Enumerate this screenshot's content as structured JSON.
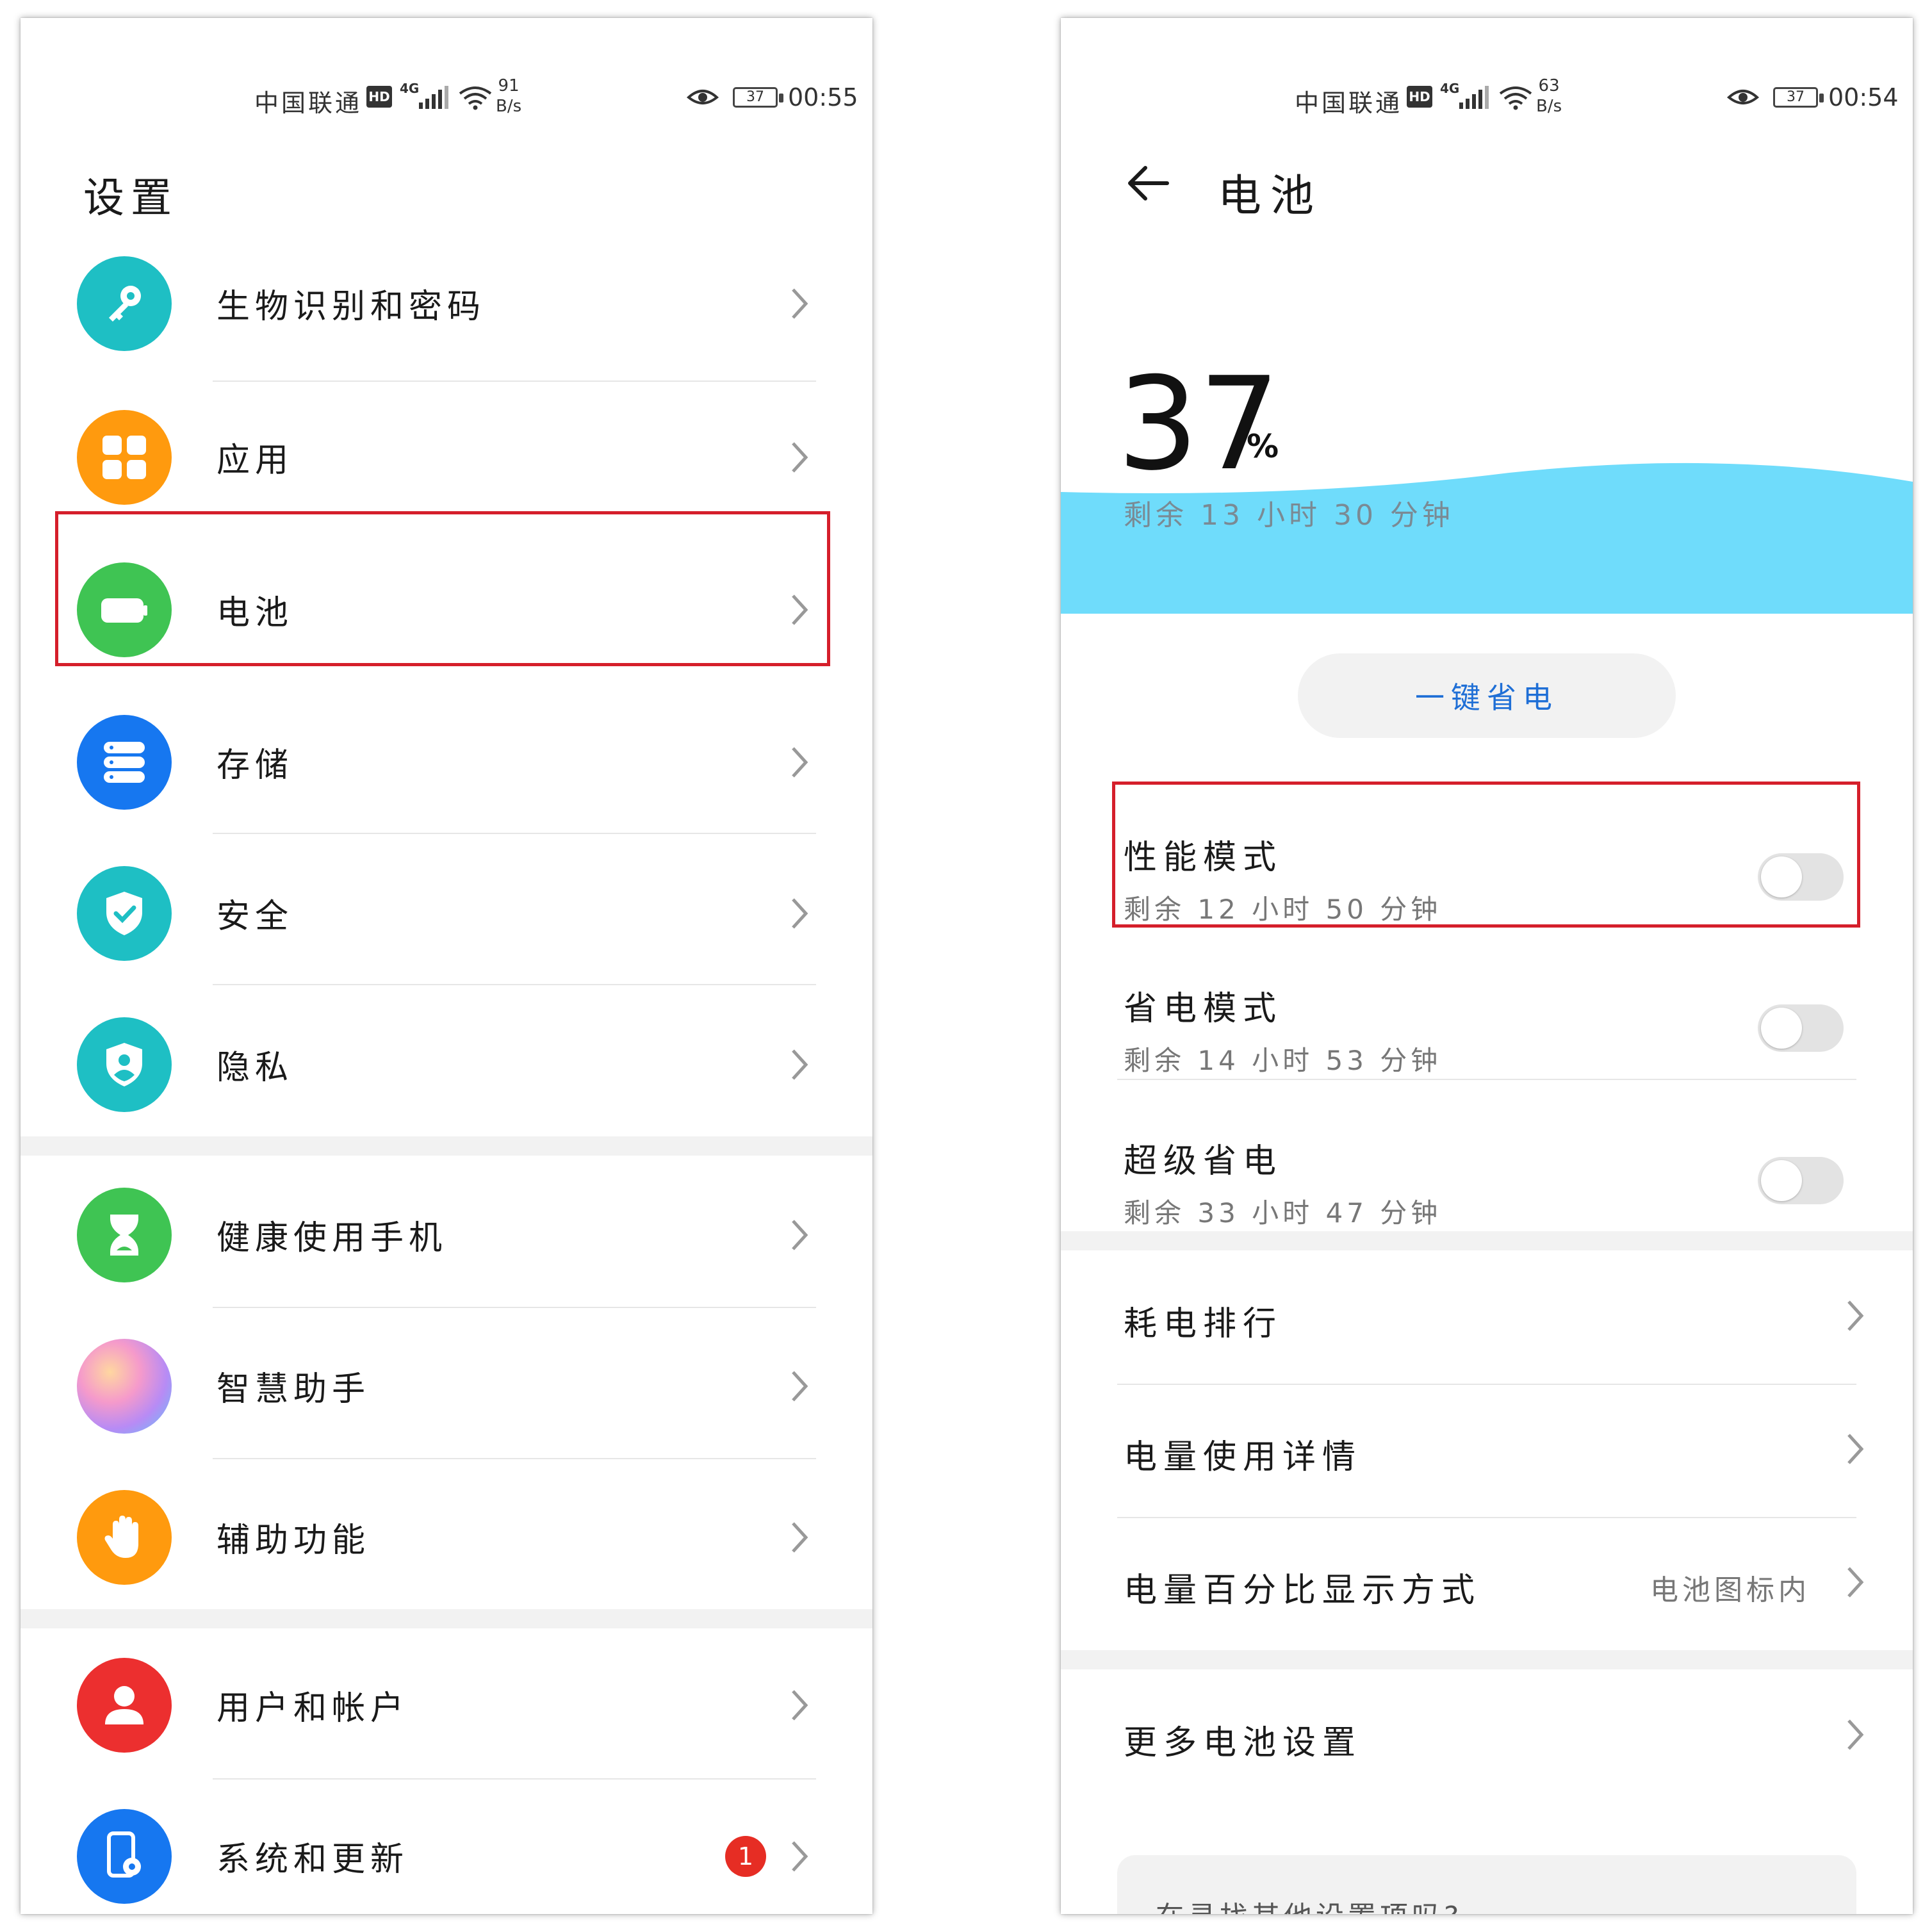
{
  "status_left": {
    "carrier": "中国联通",
    "hd": "HD",
    "network": "4G",
    "speed_value": "91",
    "speed_unit": "B/s",
    "battery": "37",
    "time": "00:55"
  },
  "status_right": {
    "carrier": "中国联通",
    "hd": "HD",
    "network": "4G",
    "speed_value": "63",
    "speed_unit": "B/s",
    "battery": "37",
    "time": "00:54"
  },
  "settings": {
    "title": "设置",
    "items": [
      {
        "label": "生物识别和密码",
        "icon": "key-icon",
        "color": "#1ebfc4"
      },
      {
        "label": "应用",
        "icon": "apps-grid-icon",
        "color": "#ff9a0e"
      },
      {
        "label": "电池",
        "icon": "battery-icon",
        "color": "#3fc453"
      },
      {
        "label": "存储",
        "icon": "storage-icon",
        "color": "#1677f0"
      },
      {
        "label": "安全",
        "icon": "shield-check-icon",
        "color": "#1ebfc4"
      },
      {
        "label": "隐私",
        "icon": "privacy-shield-icon",
        "color": "#1ebfc4"
      },
      {
        "label": "健康使用手机",
        "icon": "hourglass-icon",
        "color": "#3fc453"
      },
      {
        "label": "智慧助手",
        "icon": "assistant-orb-icon",
        "color": "#b78bf5"
      },
      {
        "label": "辅助功能",
        "icon": "hand-icon",
        "color": "#ff9a0e"
      },
      {
        "label": "用户和帐户",
        "icon": "user-icon",
        "color": "#ec2f2f"
      },
      {
        "label": "系统和更新",
        "icon": "phone-gear-icon",
        "color": "#1677f0",
        "badge": "1"
      }
    ]
  },
  "battery": {
    "title": "电池",
    "percent": "37",
    "percent_sign": "%",
    "remaining": "剩余 13 小时 30 分钟",
    "save_button": "一键省电",
    "modes": [
      {
        "title": "性能模式",
        "subtitle": "剩余 12 小时 50 分钟",
        "on": false
      },
      {
        "title": "省电模式",
        "subtitle": "剩余 14 小时 53 分钟",
        "on": false
      },
      {
        "title": "超级省电",
        "subtitle": "剩余 33 小时 47 分钟",
        "on": false
      }
    ],
    "rows": [
      {
        "label": "耗电排行",
        "value": ""
      },
      {
        "label": "电量使用详情",
        "value": ""
      },
      {
        "label": "电量百分比显示方式",
        "value": "电池图标内"
      }
    ],
    "more": "更多电池设置",
    "search_hint": "在寻找其他设置项吗?"
  },
  "colors": {
    "highlight": "#d51f2b",
    "wave": "#6fdcfb",
    "accent": "#1f6fd6"
  }
}
